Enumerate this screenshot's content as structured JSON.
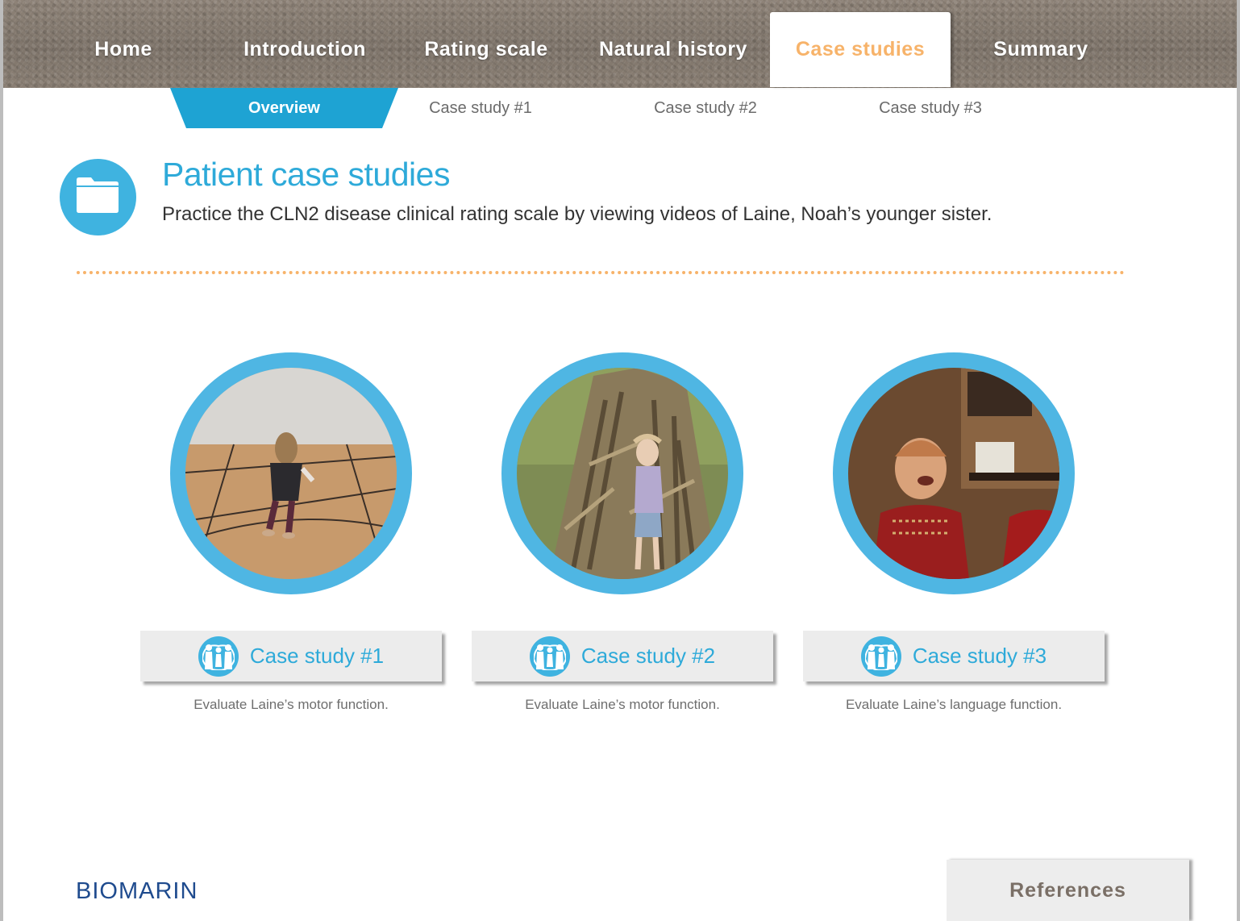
{
  "nav": {
    "items": [
      {
        "label": "Home",
        "active": false
      },
      {
        "label": "Introduction",
        "active": false
      },
      {
        "label": "Rating scale",
        "active": false
      },
      {
        "label": "Natural history",
        "active": false
      },
      {
        "label": "Case studies",
        "active": true
      },
      {
        "label": "Summary",
        "active": false
      }
    ]
  },
  "subnav": {
    "items": [
      {
        "label": "Overview",
        "active": true
      },
      {
        "label": "Case study #1",
        "active": false
      },
      {
        "label": "Case study #2",
        "active": false
      },
      {
        "label": "Case study #3",
        "active": false
      }
    ]
  },
  "header": {
    "icon": "folder-icon",
    "title": "Patient case studies",
    "subtitle": "Practice the CLN2 disease clinical rating scale by viewing videos of Laine, Noah’s younger sister."
  },
  "cases": [
    {
      "label": "Case study #1",
      "caption": "Evaluate Laine’s motor function.",
      "icon": "family-icon",
      "thumbnail": "video-thumbnail-gym"
    },
    {
      "label": "Case study #2",
      "caption": "Evaluate Laine’s motor function.",
      "icon": "family-icon",
      "thumbnail": "video-thumbnail-cornstalks"
    },
    {
      "label": "Case study #3",
      "caption": "Evaluate Laine’s language function.",
      "icon": "family-icon",
      "thumbnail": "video-thumbnail-living-room"
    }
  ],
  "footer": {
    "logo": "BIOMARIN",
    "references_label": "References"
  },
  "colors": {
    "accent_blue": "#3fb3e0",
    "title_blue": "#2eaad9",
    "accent_orange": "#f7b36a",
    "overview_tab": "#1ea3d3"
  }
}
